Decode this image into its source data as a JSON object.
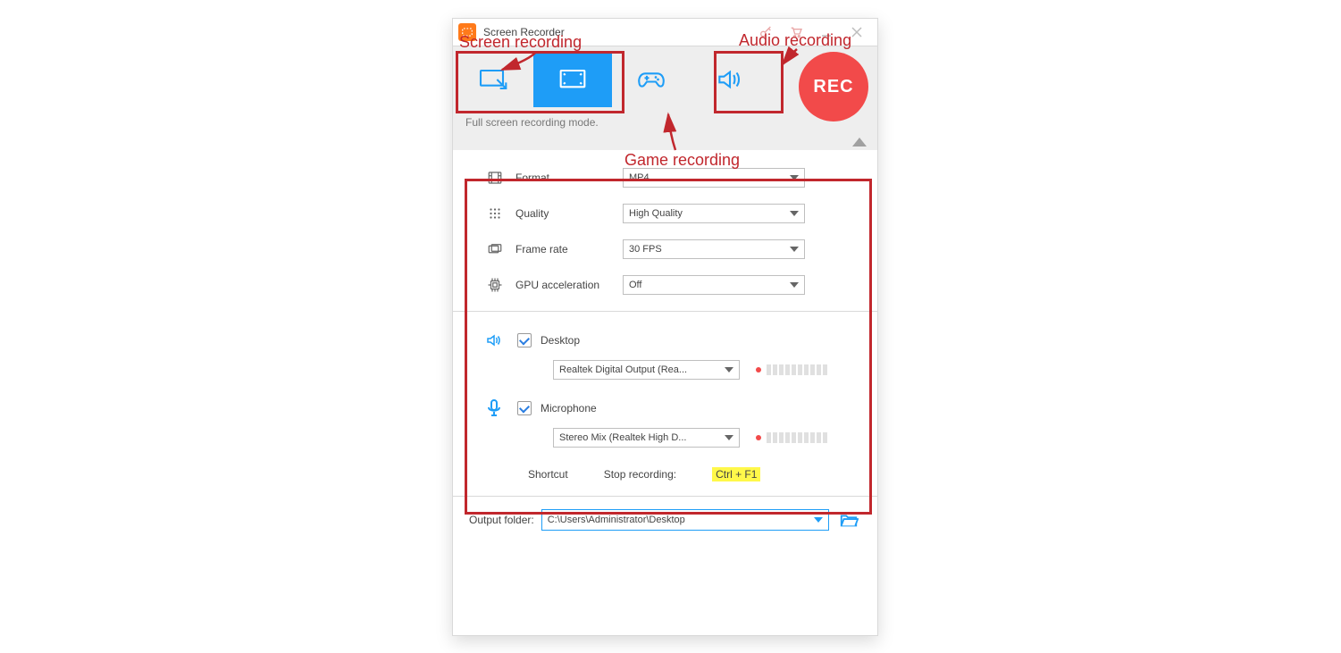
{
  "title": "Screen Recorder",
  "mode_status": "Full screen recording mode.",
  "rec_label": "REC",
  "settings": {
    "format": {
      "label": "Format",
      "value": "MP4"
    },
    "quality": {
      "label": "Quality",
      "value": "High Quality"
    },
    "fps": {
      "label": "Frame rate",
      "value": "30 FPS"
    },
    "gpu": {
      "label": "GPU acceleration",
      "value": "Off"
    }
  },
  "audio": {
    "desktop": {
      "label": "Desktop",
      "device": "Realtek Digital Output (Rea..."
    },
    "microphone": {
      "label": "Microphone",
      "device": "Stereo Mix (Realtek High D..."
    }
  },
  "shortcut": {
    "title": "Shortcut",
    "label": "Stop recording:",
    "key": "Ctrl + F1"
  },
  "output": {
    "label": "Output folder:",
    "path": "C:\\Users\\Administrator\\Desktop"
  },
  "callouts": {
    "screen": "Screen recording",
    "audio": "Audio recording",
    "game": "Game recording"
  }
}
